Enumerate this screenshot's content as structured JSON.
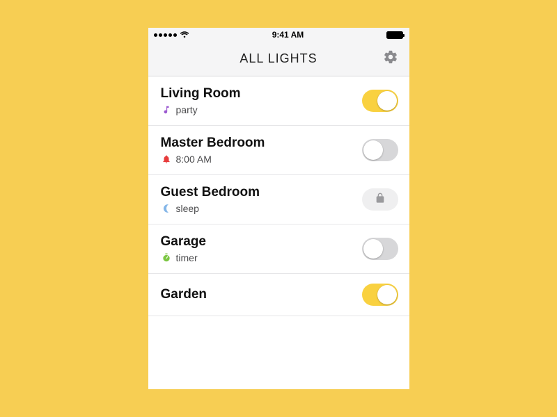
{
  "statusbar": {
    "time": "9:41 AM"
  },
  "header": {
    "title": "ALL LIGHTS"
  },
  "rooms": [
    {
      "name": "Living Room",
      "sublabel": "party",
      "subicon": "music",
      "state": "on"
    },
    {
      "name": "Master Bedroom",
      "sublabel": "8:00 AM",
      "subicon": "bell",
      "state": "off"
    },
    {
      "name": "Guest Bedroom",
      "sublabel": "sleep",
      "subicon": "moon",
      "state": "locked"
    },
    {
      "name": "Garage",
      "sublabel": "timer",
      "subicon": "timer",
      "state": "off"
    },
    {
      "name": "Garden",
      "sublabel": "",
      "subicon": "",
      "state": "on"
    }
  ]
}
